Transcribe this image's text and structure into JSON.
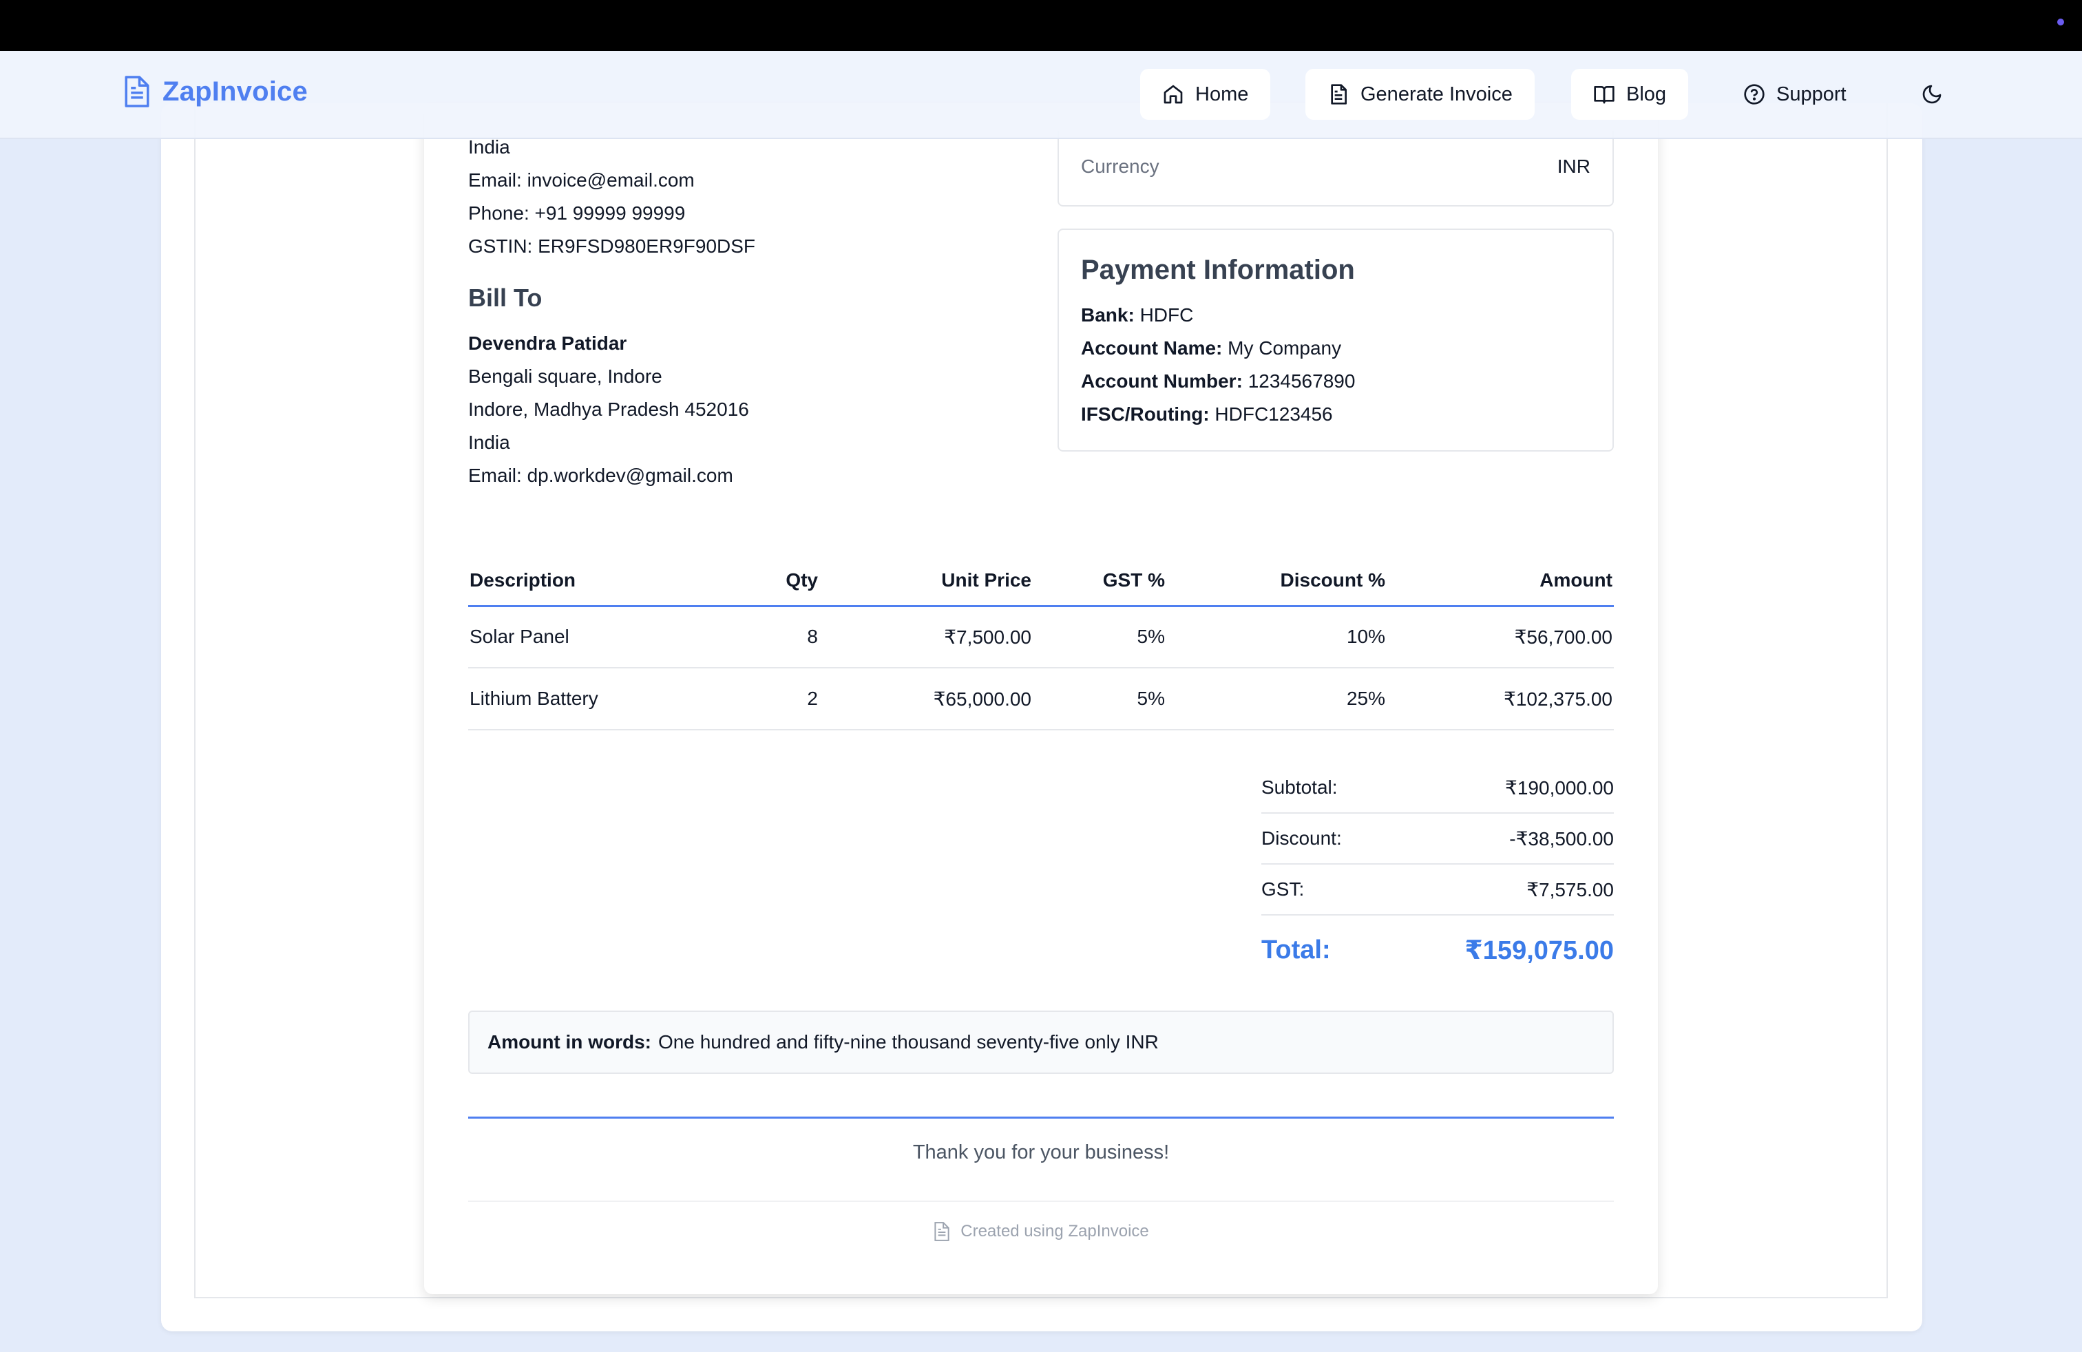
{
  "app": {
    "brand": "ZapInvoice",
    "colors": {
      "accent": "#4f7ff0",
      "total": "#3b7be8",
      "background": "#e3ebfa"
    }
  },
  "nav": {
    "home": "Home",
    "generate": "Generate Invoice",
    "blog": "Blog",
    "support": "Support",
    "theme_icon": "moon-icon"
  },
  "sender": {
    "country": "India",
    "email": "Email: invoice@email.com",
    "phone": "Phone: +91 99999 99999",
    "gstin": "GSTIN: ER9FSD980ER9F90DSF"
  },
  "bill_to": {
    "heading": "Bill To",
    "name": "Devendra Patidar",
    "address1": "Bengali square, Indore",
    "address2": "Indore, Madhya Pradesh 452016",
    "country": "India",
    "email": "Email: dp.workdev@gmail.com"
  },
  "details": {
    "currency_label": "Currency",
    "currency_value": "INR"
  },
  "payment": {
    "title": "Payment Information",
    "bank_label": "Bank:",
    "bank_value": "HDFC",
    "account_name_label": "Account Name:",
    "account_name_value": "My Company",
    "account_number_label": "Account Number:",
    "account_number_value": "1234567890",
    "ifsc_label": "IFSC/Routing:",
    "ifsc_value": "HDFC123456"
  },
  "items": {
    "headers": {
      "description": "Description",
      "qty": "Qty",
      "unit_price": "Unit Price",
      "gst": "GST %",
      "discount": "Discount %",
      "amount": "Amount"
    },
    "rows": [
      {
        "description": "Solar Panel",
        "qty": "8",
        "unit_price": "₹7,500.00",
        "gst": "5%",
        "discount": "10%",
        "amount": "₹56,700.00"
      },
      {
        "description": "Lithium Battery",
        "qty": "2",
        "unit_price": "₹65,000.00",
        "gst": "5%",
        "discount": "25%",
        "amount": "₹102,375.00"
      }
    ]
  },
  "totals": {
    "subtotal_label": "Subtotal:",
    "subtotal_value": "₹190,000.00",
    "discount_label": "Discount:",
    "discount_value": "-₹38,500.00",
    "gst_label": "GST:",
    "gst_value": "₹7,575.00",
    "total_label": "Total:",
    "total_value": "₹159,075.00"
  },
  "amount_in_words": {
    "label": "Amount in words:",
    "value": "One hundred and fifty-nine thousand seventy-five only INR"
  },
  "footer": {
    "thanks": "Thank you for your business!",
    "created": "Created using ZapInvoice"
  }
}
